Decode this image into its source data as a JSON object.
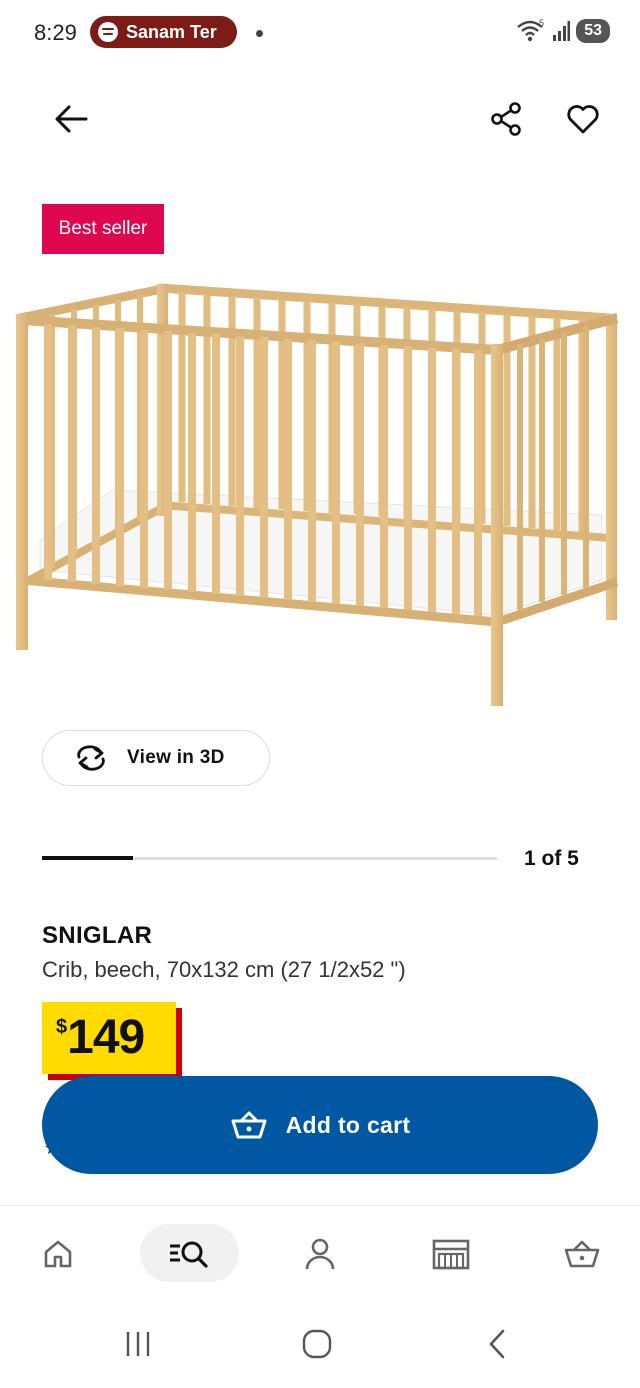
{
  "status_bar": {
    "time": "8:29",
    "media_app": "Sanam Ter",
    "battery": "53",
    "wifi_label": "5"
  },
  "header": {
    "back_icon": "arrow-left-icon",
    "share_icon": "share-icon",
    "favorite_icon": "heart-icon"
  },
  "badge": {
    "label": "Best seller",
    "color": "#e00751"
  },
  "view_3d": {
    "label": "View in 3D",
    "icon": "rotate-3d-icon"
  },
  "gallery": {
    "counter": "1 of 5",
    "current": 1,
    "total": 5
  },
  "product": {
    "name": "SNIGLAR",
    "description": "Crib, beech, 70x132 cm (27 1/2x52 \")",
    "price_currency": "$",
    "price_amount": "149"
  },
  "cart_button": {
    "label": "Add to cart",
    "color": "#0058a3"
  },
  "bottom_nav": {
    "items": [
      {
        "icon": "home-icon",
        "active": false
      },
      {
        "icon": "search-list-icon",
        "active": true
      },
      {
        "icon": "profile-icon",
        "active": false
      },
      {
        "icon": "store-icon",
        "active": false
      },
      {
        "icon": "basket-icon",
        "active": false
      }
    ]
  },
  "colors": {
    "price_bg": "#ffdb00",
    "price_accent": "#cc0008",
    "brand_blue": "#0058a3"
  }
}
